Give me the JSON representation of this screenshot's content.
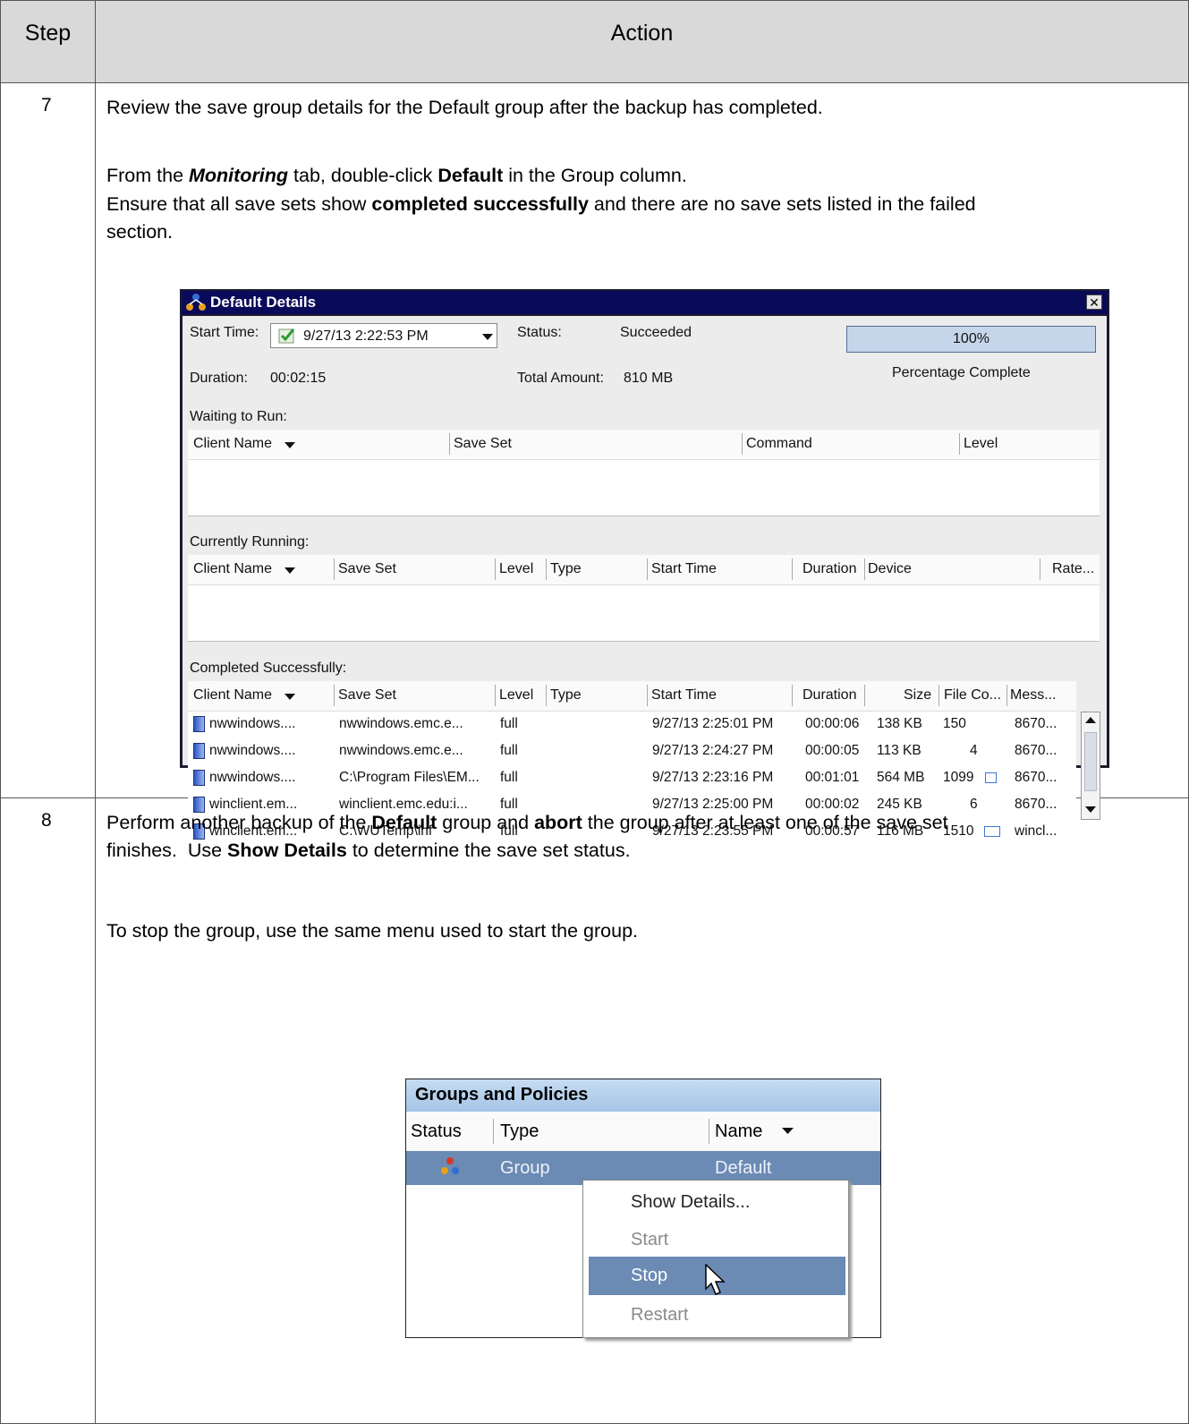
{
  "table": {
    "headers": {
      "step": "Step",
      "action": "Action"
    }
  },
  "steps": [
    {
      "number": "7",
      "lines": [
        [
          "Review the save group details for the Default group after the backup has completed."
        ],
        [
          "From the ",
          "Monitoring",
          " tab, double-click ",
          "Default",
          " in the Group column."
        ],
        [
          "Ensure that all save sets show ",
          "completed successfully",
          " and there are no save sets listed in the failed"
        ],
        [
          "section."
        ]
      ]
    },
    {
      "number": "8",
      "lines": [
        [
          "Perform another backup of the ",
          "Default",
          " group and ",
          "abort",
          " the group after at least one of the save set"
        ],
        [
          "finishes.  Use ",
          "Show Details",
          " to determine the save set status."
        ],
        [
          "To stop the group, use the same menu used to start the group."
        ]
      ]
    }
  ],
  "details_window": {
    "title": "Default Details",
    "close": "✕",
    "start_time_label": "Start Time:",
    "start_time_value": "9/27/13 2:22:53 PM",
    "status_label": "Status:",
    "status_value": "Succeeded",
    "progress": {
      "percent": 100,
      "text": "100%"
    },
    "percent_complete_label": "Percentage Complete",
    "duration_label": "Duration:",
    "duration_value": "00:02:15",
    "total_amount_label": "Total Amount:",
    "total_amount_value": "810 MB",
    "waiting": {
      "label": "Waiting to Run:",
      "columns": [
        "Client Name",
        "Save Set",
        "Command",
        "Level"
      ]
    },
    "running": {
      "label": "Currently Running:",
      "columns": [
        "Client Name",
        "Save Set",
        "Level",
        "Type",
        "Start Time",
        "Duration",
        "Device",
        "Rate..."
      ]
    },
    "completed": {
      "label": "Completed Successfully:",
      "columns": [
        "Client Name",
        "Save Set",
        "Level",
        "Type",
        "Start Time",
        "Duration",
        "Size",
        "File Co...",
        "Mess..."
      ],
      "rows": [
        [
          "nwwindows....",
          "nwwindows.emc.e...",
          "full",
          "",
          "9/27/13 2:25:01 PM",
          "00:00:06",
          "138 KB",
          "150",
          "8670..."
        ],
        [
          "nwwindows....",
          "nwwindows.emc.e...",
          "full",
          "",
          "9/27/13 2:24:27 PM",
          "00:00:05",
          "113 KB",
          "4",
          "8670..."
        ],
        [
          "nwwindows....",
          "C:\\Program Files\\EM...",
          "full",
          "",
          "9/27/13 2:23:16 PM",
          "00:01:01",
          "564 MB",
          "1099",
          "8670..."
        ],
        [
          "winclient.em...",
          "winclient.emc.edu:i...",
          "full",
          "",
          "9/27/13 2:25:00 PM",
          "00:00:02",
          "245 KB",
          "6",
          "8670..."
        ],
        [
          "winclient.em...",
          "C:\\WUTemp\\inf",
          "full",
          "",
          "9/27/13 2:23:55 PM",
          "00:00:57",
          "116 MB",
          "1510",
          "wincl..."
        ]
      ]
    }
  },
  "groups_policies": {
    "title": "Groups and Policies",
    "columns": [
      "Status",
      "Type",
      "Name"
    ],
    "row": {
      "type": "Group",
      "name": "Default"
    },
    "menu": [
      "Show Details...",
      "Start",
      "Stop",
      "Restart"
    ]
  }
}
